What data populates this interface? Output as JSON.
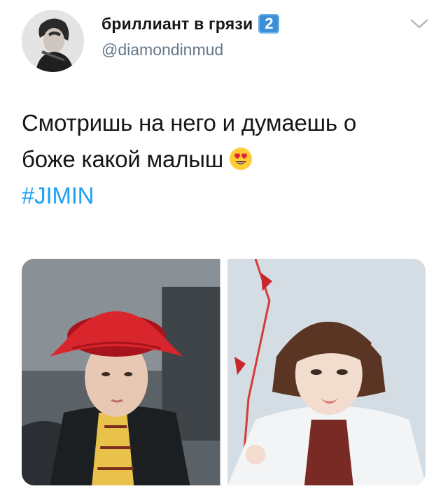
{
  "tweet": {
    "display_name": "бриллиант в грязи",
    "badge": "2",
    "handle": "@diamondinmud",
    "text_lines": [
      "Смотришь на него и думаешь о",
      "боже какой малыш"
    ],
    "emoji": "smiling-face-with-heart-eyes",
    "hashtag": "#JIMIN",
    "colors": {
      "hashtag": "#1da1f2",
      "handle": "#657786",
      "badge": "#3b8fd6",
      "hat": "#d9262c"
    }
  }
}
